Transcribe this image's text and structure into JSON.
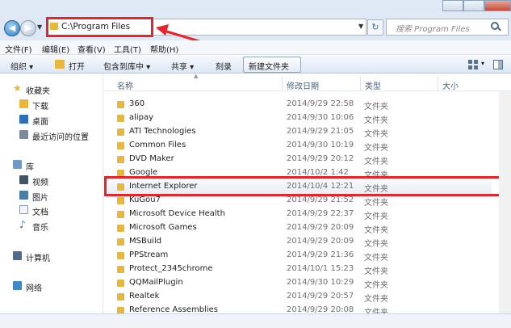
{
  "address": {
    "path": "C:\\Program Files"
  },
  "search": {
    "placeholder": "搜索 Program Files"
  },
  "menu": [
    "文件(F)",
    "编辑(E)",
    "查看(V)",
    "工具(T)",
    "帮助(H)"
  ],
  "toolbar": {
    "organize": "组织 ▾",
    "open": "打开",
    "include": "包含到库中 ▾",
    "share": "共享 ▾",
    "burn": "刻录",
    "new_folder": "新建文件夹"
  },
  "sidebar": {
    "favorites": "收藏夹",
    "downloads": "下载",
    "desktop": "桌面",
    "recent": "最近访问的位置",
    "libraries": "库",
    "videos": "视频",
    "pictures": "图片",
    "documents": "文档",
    "music": "音乐",
    "computer": "计算机",
    "network": "网络"
  },
  "columns": {
    "name": "名称",
    "modified": "修改日期",
    "type": "类型",
    "size": "大小"
  },
  "rows": [
    {
      "name": "360",
      "date": "2014/9/29 22:58",
      "type": "文件夹"
    },
    {
      "name": "alipay",
      "date": "2014/9/30 10:06",
      "type": "文件夹"
    },
    {
      "name": "ATI Technologies",
      "date": "2014/9/29 21:05",
      "type": "文件夹"
    },
    {
      "name": "Common Files",
      "date": "2014/9/30 10:19",
      "type": "文件夹"
    },
    {
      "name": "DVD Maker",
      "date": "2014/9/29 20:12",
      "type": "文件夹"
    },
    {
      "name": "Google",
      "date": "2014/10/2 1:42",
      "type": "文件夹"
    },
    {
      "name": "Internet Explorer",
      "date": "2014/10/4 12:21",
      "type": "文件夹"
    },
    {
      "name": "KuGou7",
      "date": "2014/9/29 21:52",
      "type": "文件夹"
    },
    {
      "name": "Microsoft Device Health",
      "date": "2014/9/29 22:37",
      "type": "文件夹"
    },
    {
      "name": "Microsoft Games",
      "date": "2014/9/29 20:09",
      "type": "文件夹"
    },
    {
      "name": "MSBuild",
      "date": "2014/9/29 20:09",
      "type": "文件夹"
    },
    {
      "name": "PPStream",
      "date": "2014/9/29 21:36",
      "type": "文件夹"
    },
    {
      "name": "Protect_2345chrome",
      "date": "2014/10/1 15:23",
      "type": "文件夹"
    },
    {
      "name": "QQMailPlugin",
      "date": "2014/9/30 10:29",
      "type": "文件夹"
    },
    {
      "name": "Realtek",
      "date": "2014/9/29 20:57",
      "type": "文件夹"
    },
    {
      "name": "Reference Assemblies",
      "date": "2014/9/29 20:08",
      "type": "文件夹"
    }
  ]
}
